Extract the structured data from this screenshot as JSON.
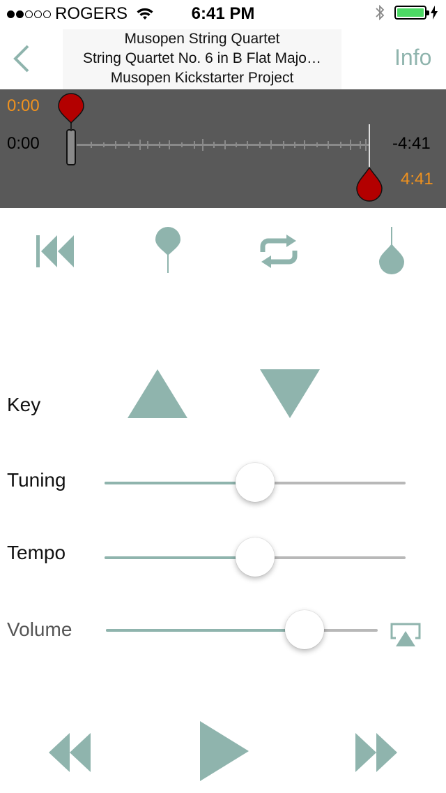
{
  "status_bar": {
    "carrier": "ROGERS",
    "signal_filled": 2,
    "signal_total": 5,
    "time": "6:41 PM",
    "battery_level": 1.0
  },
  "nav": {
    "back_icon": "chevron-left-icon",
    "line1": "Musopen String Quartet",
    "line2": "String Quartet No. 6 in B Flat Majo…",
    "line3": "Musopen Kickstarter Project",
    "info_label": "Info"
  },
  "waveform": {
    "loop_start_label": "0:00",
    "current_time": "0:00",
    "remaining_time": "-4:41",
    "loop_end_label": "4:41"
  },
  "controls": {
    "icons": [
      "skip-to-start-icon",
      "set-start-marker-icon",
      "loop-icon",
      "set-end-marker-icon"
    ]
  },
  "key": {
    "label": "Key"
  },
  "tuning": {
    "label": "Tuning",
    "value": 0.5
  },
  "tempo": {
    "label": "Tempo",
    "value": 0.5
  },
  "volume": {
    "label": "Volume",
    "value": 0.73,
    "airplay_icon": "airplay-icon"
  },
  "transport": {
    "icons": [
      "rewind-icon",
      "play-icon",
      "fast-forward-icon"
    ]
  },
  "colors": {
    "accent": "#8fb4ad",
    "marker_red": "#b30000",
    "time_orange": "#f0921e",
    "waveform_bg": "#595959"
  }
}
